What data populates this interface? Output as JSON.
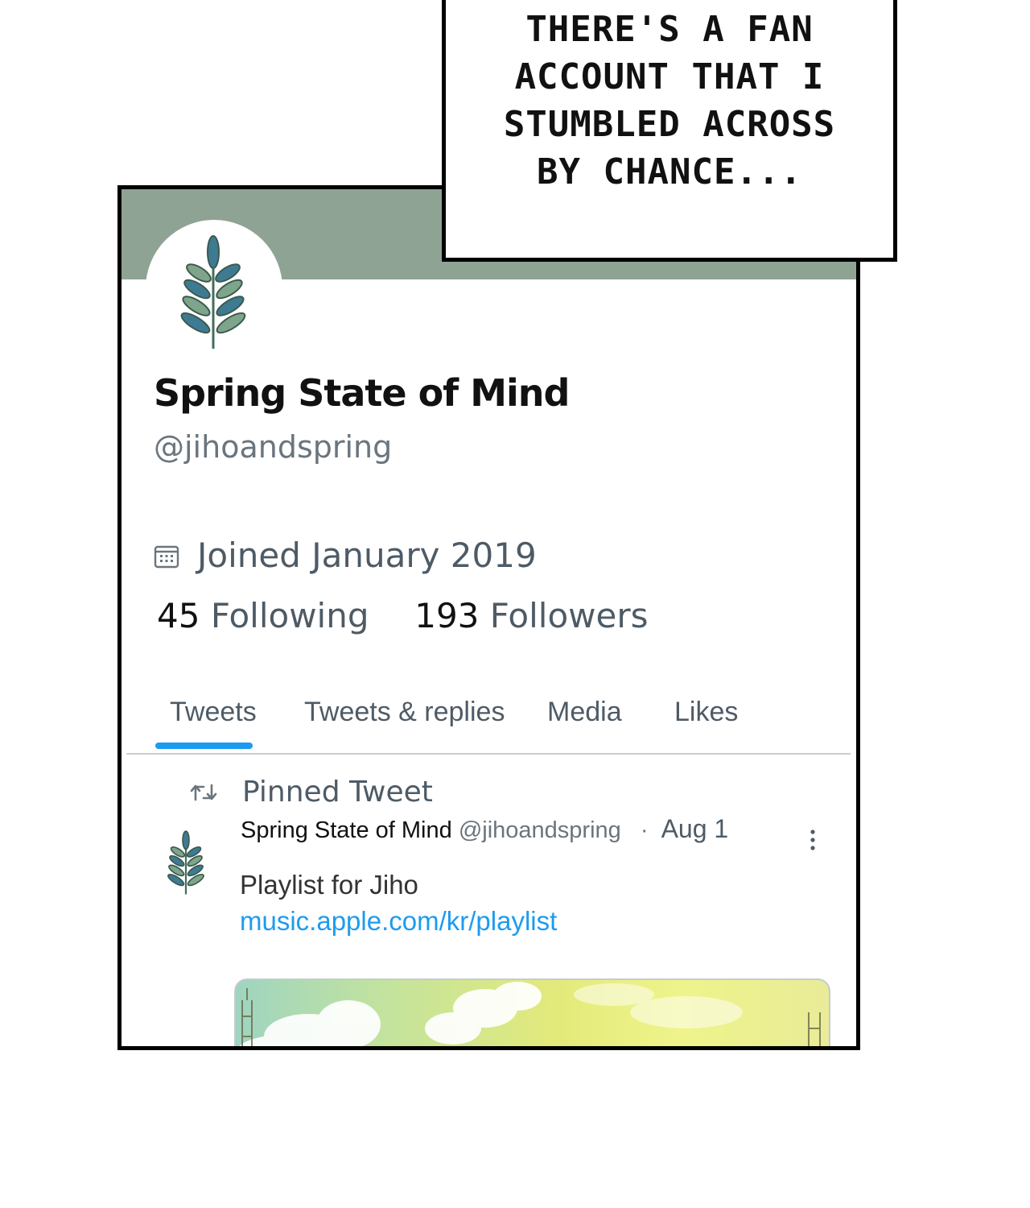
{
  "caption": {
    "text": "THERE'S A FAN\nACCOUNT THAT I\nSTUMBLED ACROSS\nBY CHANCE..."
  },
  "profile": {
    "name": "Spring State of Mind",
    "handle": "@jihoandspring",
    "joined": "Joined January 2019",
    "following_count": "45",
    "following_label": "Following",
    "followers_count": "193",
    "followers_label": "Followers",
    "banner_color": "#8fa394",
    "avatar_icon": "leaf-sprig-icon"
  },
  "tabs": [
    {
      "label": "Tweets",
      "active": true
    },
    {
      "label": "Tweets & replies",
      "active": false
    },
    {
      "label": "Media",
      "active": false
    },
    {
      "label": "Likes",
      "active": false
    }
  ],
  "pinned_tweet": {
    "pinned_label": "Pinned Tweet",
    "author": "Spring State of Mind",
    "handle": "@jihoandspring",
    "separator": "·",
    "date": "Aug 1",
    "text": "Playlist for Jiho",
    "link": "music.apple.com/kr/playlist"
  },
  "colors": {
    "accent": "#1d9bf0",
    "secondary_text": "#4e5b66"
  }
}
